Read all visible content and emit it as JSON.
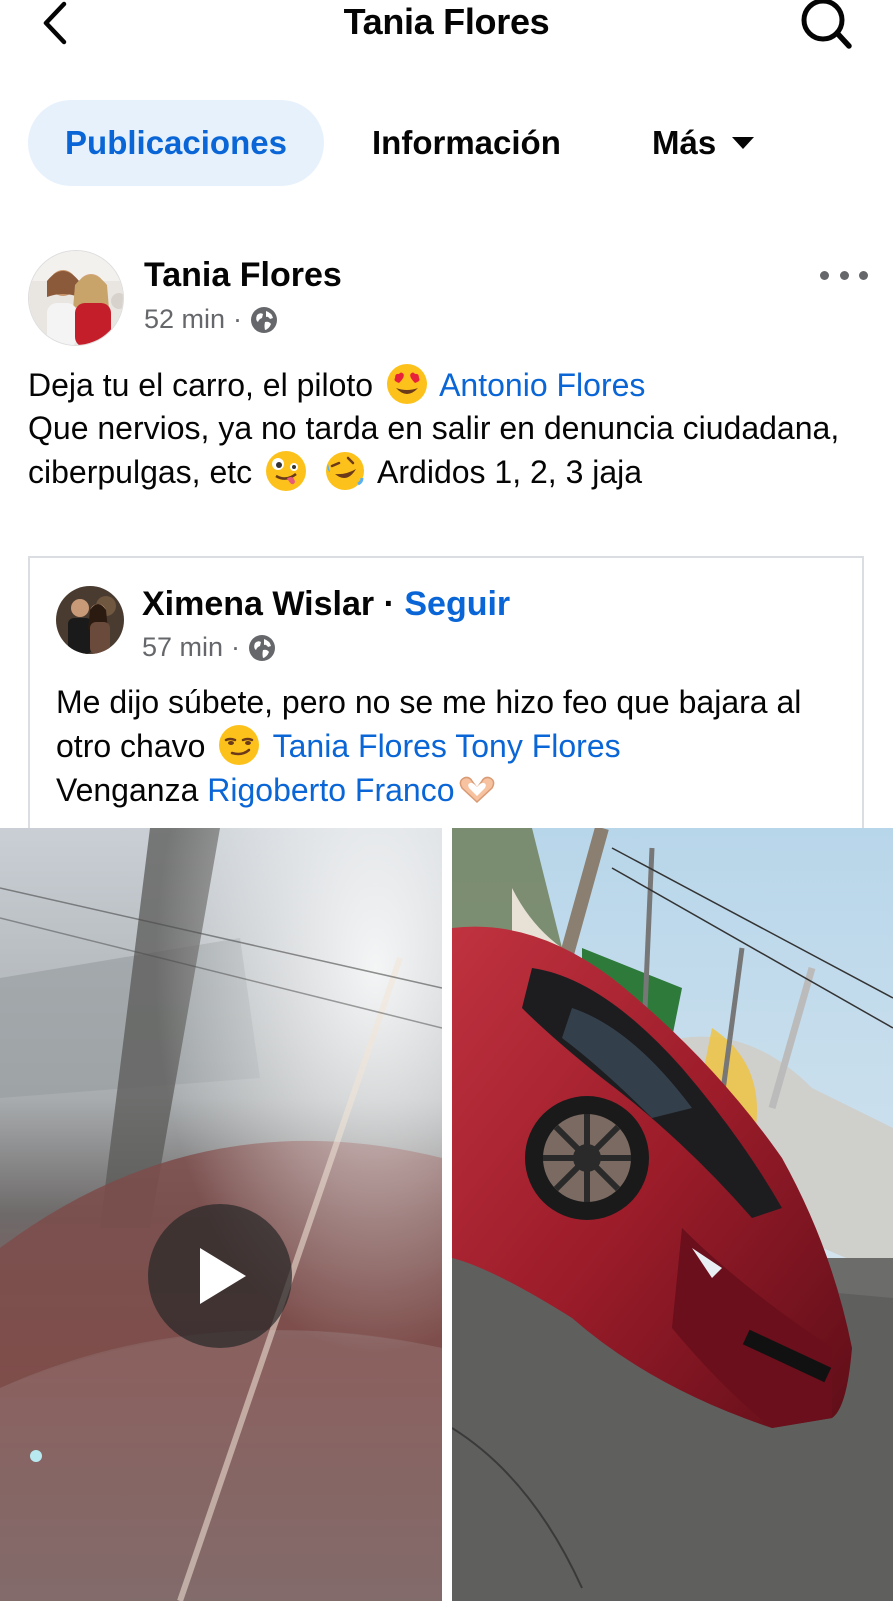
{
  "header": {
    "title": "Tania Flores",
    "back_icon": "chevron-left-icon",
    "search_icon": "search-icon"
  },
  "tabs": [
    {
      "label": "Publicaciones",
      "active": true
    },
    {
      "label": "Información",
      "active": false
    },
    {
      "label": "Más",
      "active": false
    }
  ],
  "post": {
    "author": "Tania Flores",
    "time": "52 min",
    "separator": "·",
    "audience_icon": "globe-icon",
    "text_parts": {
      "p1": "Deja tu el carro, el piloto",
      "mention1": "Antonio Flores",
      "p2": "Que nervios, ya no tarda en salir en denuncia ciudadana, ciberpulgas, etc",
      "p3": "Ardidos 1, 2, 3 jaja"
    }
  },
  "shared_post": {
    "author": "Ximena Wislar",
    "separator": "·",
    "follow_label": "Seguir",
    "time": "57 min",
    "text_parts": {
      "p1": "Me dijo súbete, pero no se me hizo feo que bajara al otro chavo",
      "mention1": "Tania Flores",
      "mention2": "Tony Flores",
      "p2": "Venganza",
      "mention3": "Rigoberto Franco"
    }
  },
  "colors": {
    "accent": "#0a66d6",
    "active_tab_bg": "#e7f1fc",
    "secondary_text": "#65676b",
    "car_red": "#9c1c2a"
  }
}
